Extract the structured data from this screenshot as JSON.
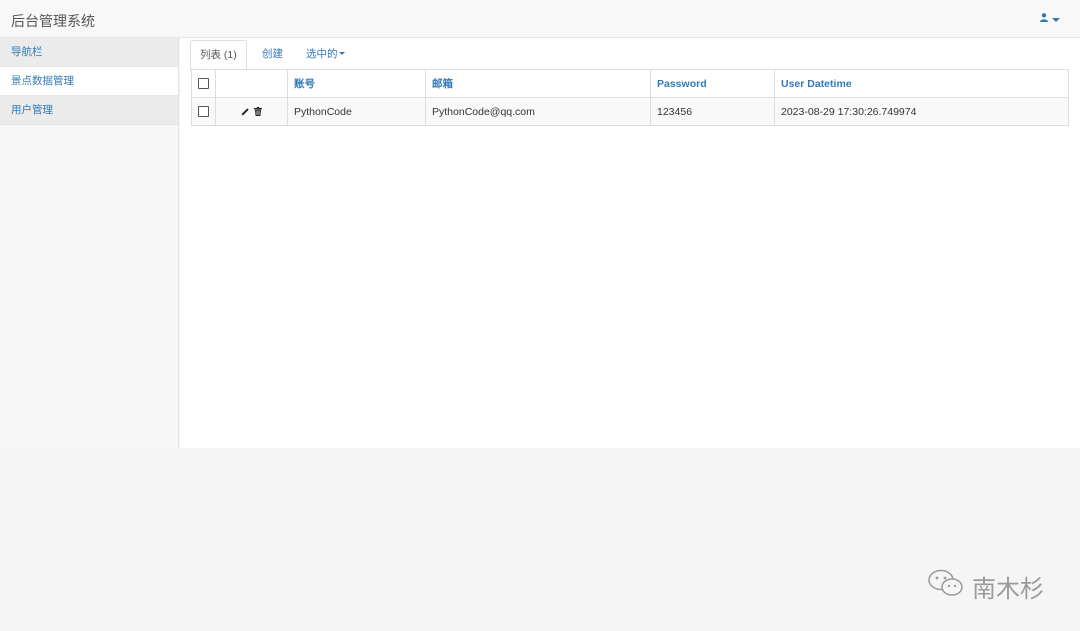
{
  "app": {
    "title": "后台管理系统"
  },
  "sidebar": {
    "items": [
      {
        "label": "导航栏"
      },
      {
        "label": "景点数据管理"
      },
      {
        "label": "用户管理"
      }
    ]
  },
  "tabs": {
    "list_label": "列表 (1)",
    "create_label": "创建",
    "selected_label": "选中的"
  },
  "table": {
    "columns": [
      "账号",
      "邮箱",
      "Password",
      "User Datetime"
    ],
    "rows": [
      {
        "account": "PythonCode",
        "email": "PythonCode@qq.com",
        "password": "123456",
        "datetime": "2023-08-29 17:30:26.749974"
      }
    ]
  },
  "watermark": {
    "text": "南木杉"
  },
  "colors": {
    "link": "#337ab7",
    "navbar": "#f8f8f8"
  }
}
